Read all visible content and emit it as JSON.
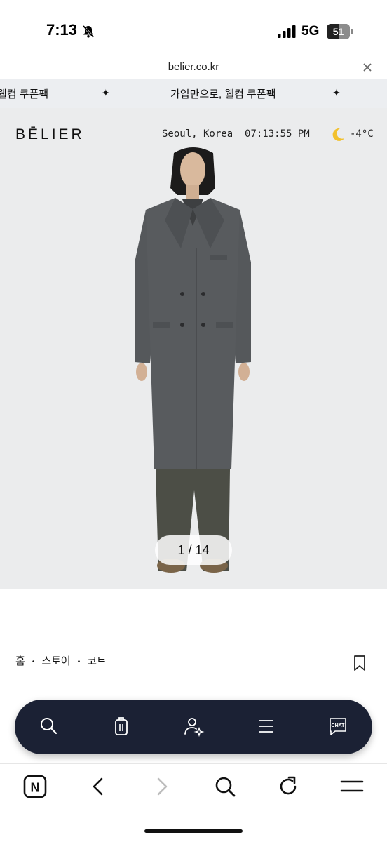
{
  "status_bar": {
    "time": "7:13",
    "network": "5G",
    "battery_level": "51",
    "battery_fraction": 0.51
  },
  "address_bar": {
    "domain": "belier.co.kr"
  },
  "promo": {
    "text_partial": "웰컴 쿠폰팩",
    "text_full": "가입만으로, 웰컴 쿠폰팩",
    "separator": "✦"
  },
  "hero": {
    "brand": "BĒLIER",
    "location": "Seoul, Korea",
    "clock": "07:13:55 PM",
    "temperature": "-4°C",
    "weather_icon": "moon-icon",
    "slide_counter": "1 / 14"
  },
  "breadcrumb": {
    "items": [
      "홈",
      "스토어",
      "코트"
    ],
    "separator": "•"
  },
  "floating_nav": {
    "items": [
      {
        "icon": "search-icon"
      },
      {
        "icon": "shopping-bag-icon"
      },
      {
        "icon": "account-sparkle-icon"
      },
      {
        "icon": "menu-icon"
      },
      {
        "icon": "chat-icon",
        "label": "CHAT"
      }
    ]
  },
  "browser_toolbar": {
    "items": [
      {
        "icon": "naver-home-icon",
        "label": "N"
      },
      {
        "icon": "back-icon"
      },
      {
        "icon": "forward-icon"
      },
      {
        "icon": "search-icon"
      },
      {
        "icon": "reload-icon"
      },
      {
        "icon": "menu-icon"
      }
    ]
  },
  "colors": {
    "nav_background": "#1b2134",
    "hero_background": "#ebeced",
    "promo_background": "#eceef1",
    "coat": "#55585b"
  }
}
